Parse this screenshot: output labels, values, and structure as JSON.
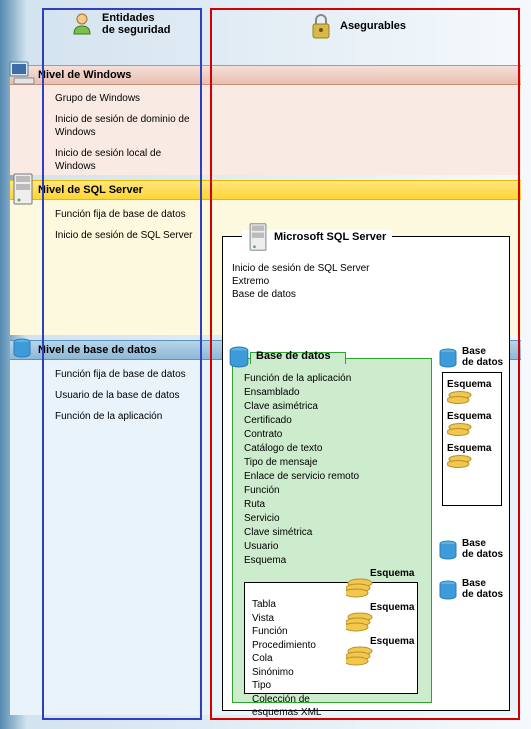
{
  "columns": {
    "left_title": "Entidades\nde seguridad",
    "right_title": "Asegurables"
  },
  "levels": {
    "windows": {
      "header": "Nivel de Windows",
      "items": [
        "Grupo de Windows",
        "Inicio de sesión de dominio de Windows",
        "Inicio de sesión local de Windows"
      ]
    },
    "sqlserver": {
      "header": "Nivel de SQL Server",
      "items": [
        "Función fija de base de datos",
        "Inicio de sesión de SQL Server"
      ]
    },
    "database": {
      "header": "Nivel de base de datos",
      "items": [
        "Función fija de base de datos",
        "Usuario de la base de datos",
        "Función de la aplicación"
      ]
    }
  },
  "securables": {
    "server": {
      "title": "Microsoft SQL Server",
      "items": [
        "Inicio de sesión de SQL Server",
        "Extremo",
        "Base de datos"
      ]
    },
    "database": {
      "title": "Base de datos",
      "items": [
        "Función de la aplicación",
        "Ensamblado",
        "Clave asimétrica",
        "Certificado",
        "Contrato",
        "Catálogo de texto",
        "Tipo de mensaje",
        "Enlace de servicio remoto",
        "Función",
        "Ruta",
        "Servicio",
        "Clave simétrica",
        "Usuario",
        "Esquema"
      ],
      "side_label": "Base\nde datos"
    },
    "schema": {
      "label": "Esquema",
      "items": [
        "Tabla",
        "Vista",
        "Función",
        "Procedimiento",
        "Cola",
        "Sinónimo",
        "Tipo",
        "Colección de esquemas XML"
      ]
    }
  },
  "icons": {
    "user": "user-icon",
    "lock": "lock-icon",
    "computer": "computer-icon",
    "server": "server-icon",
    "database": "database-icon",
    "disk": "disk-icon"
  }
}
